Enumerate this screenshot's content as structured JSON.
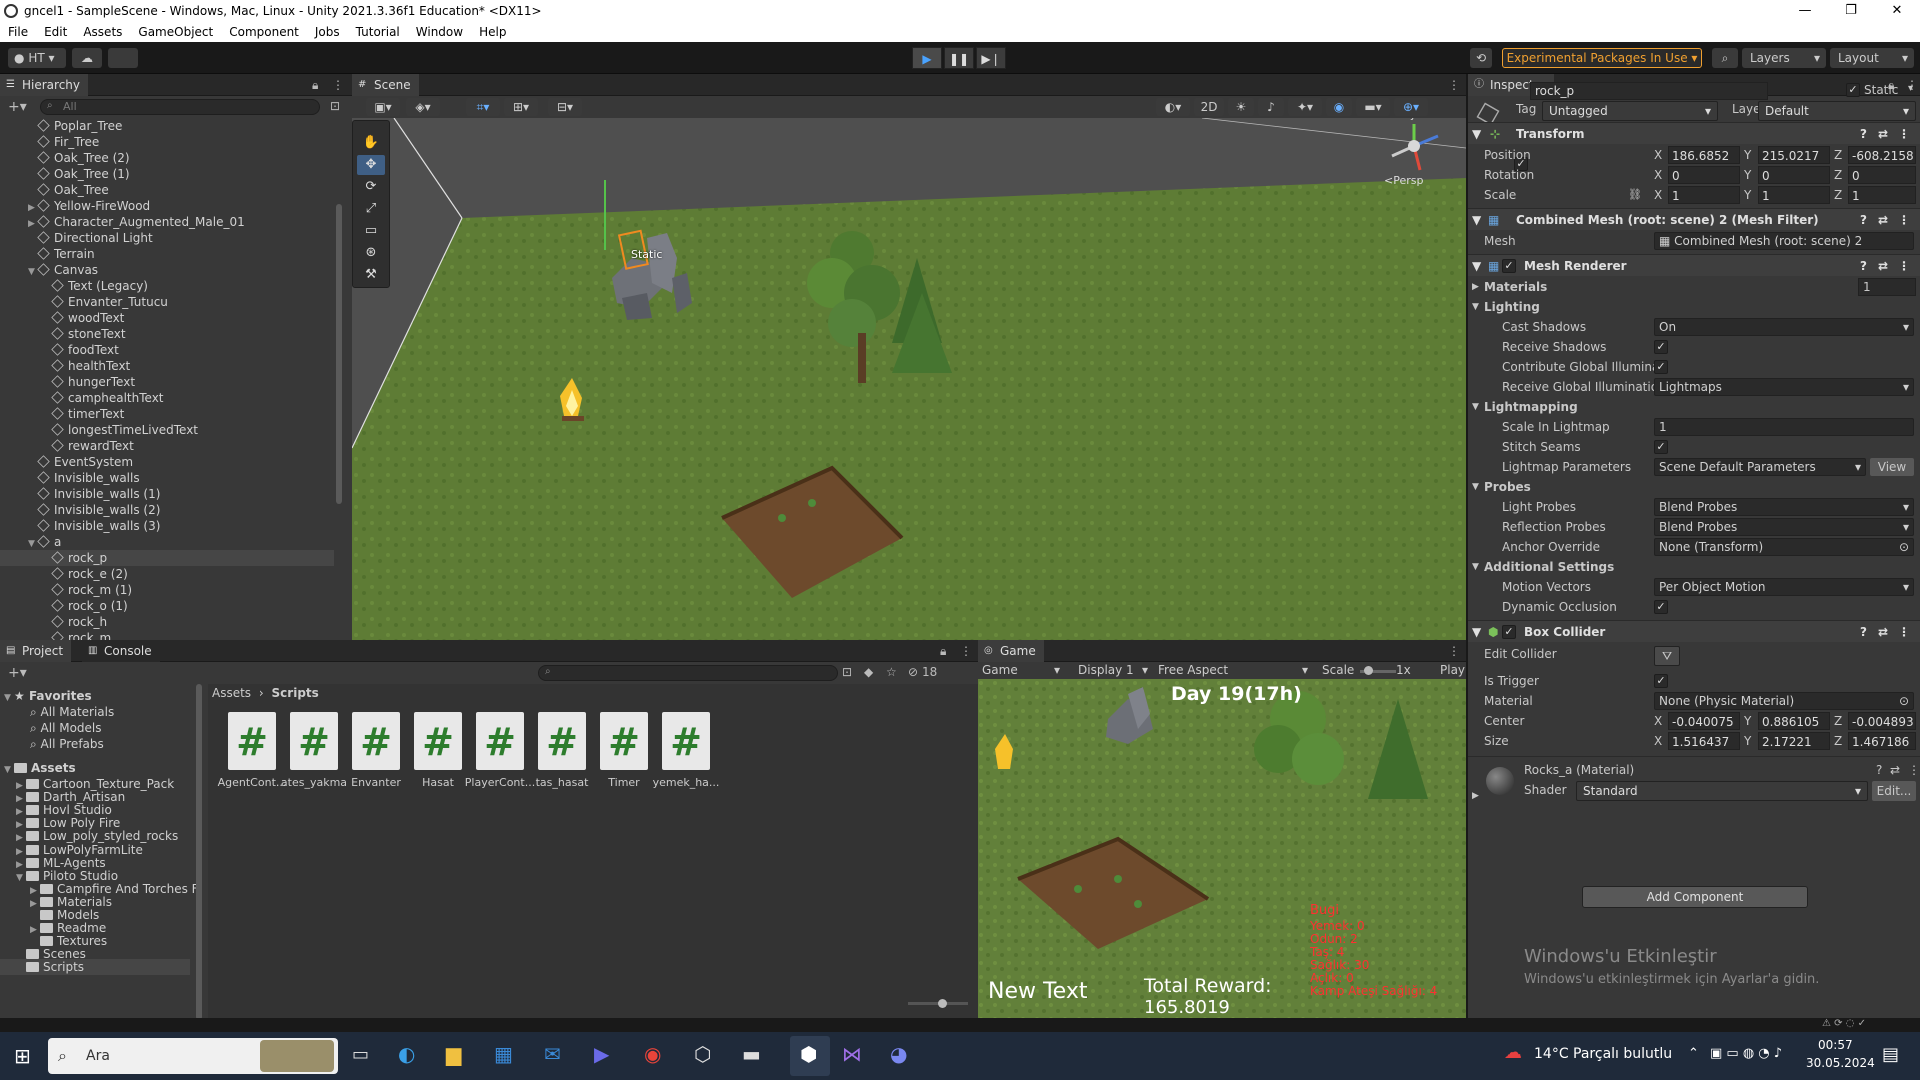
{
  "window": {
    "title": "gncel1 - SampleScene - Windows, Mac, Linux - Unity 2021.3.36f1 Education* <DX11>",
    "controls": [
      "—",
      "❐",
      "✕"
    ]
  },
  "menu": [
    "File",
    "Edit",
    "Assets",
    "GameObject",
    "Component",
    "Jobs",
    "Tutorial",
    "Window",
    "Help"
  ],
  "toolbar": {
    "account": "HT",
    "experimental": "Experimental Packages In Use",
    "layers": "Layers",
    "layout": "Layout"
  },
  "hierarchy": {
    "title": "Hierarchy",
    "search_placeholder": "All",
    "items": [
      {
        "label": "Poplar_Tree",
        "depth": 1,
        "arrow": ""
      },
      {
        "label": "Fir_Tree",
        "depth": 1,
        "arrow": ""
      },
      {
        "label": "Oak_Tree (2)",
        "depth": 1,
        "arrow": ""
      },
      {
        "label": "Oak_Tree (1)",
        "depth": 1,
        "arrow": ""
      },
      {
        "label": "Oak_Tree",
        "depth": 1,
        "arrow": ""
      },
      {
        "label": "Yellow-FireWood",
        "depth": 1,
        "arrow": "▶"
      },
      {
        "label": "Character_Augmented_Male_01",
        "depth": 1,
        "arrow": "▶"
      },
      {
        "label": "Directional Light",
        "depth": 1,
        "arrow": ""
      },
      {
        "label": "Terrain",
        "depth": 1,
        "arrow": ""
      },
      {
        "label": "Canvas",
        "depth": 1,
        "arrow": "▼"
      },
      {
        "label": "Text (Legacy)",
        "depth": 2,
        "arrow": ""
      },
      {
        "label": "Envanter_Tutucu",
        "depth": 2,
        "arrow": ""
      },
      {
        "label": "woodText",
        "depth": 2,
        "arrow": ""
      },
      {
        "label": "stoneText",
        "depth": 2,
        "arrow": ""
      },
      {
        "label": "foodText",
        "depth": 2,
        "arrow": ""
      },
      {
        "label": "healthText",
        "depth": 2,
        "arrow": ""
      },
      {
        "label": "hungerText",
        "depth": 2,
        "arrow": ""
      },
      {
        "label": "camphealthText",
        "depth": 2,
        "arrow": ""
      },
      {
        "label": "timerText",
        "depth": 2,
        "arrow": ""
      },
      {
        "label": "longestTimeLivedText",
        "depth": 2,
        "arrow": ""
      },
      {
        "label": "rewardText",
        "depth": 2,
        "arrow": ""
      },
      {
        "label": "EventSystem",
        "depth": 1,
        "arrow": ""
      },
      {
        "label": "Invisible_walls",
        "depth": 1,
        "arrow": ""
      },
      {
        "label": "Invisible_walls (1)",
        "depth": 1,
        "arrow": ""
      },
      {
        "label": "Invisible_walls (2)",
        "depth": 1,
        "arrow": ""
      },
      {
        "label": "Invisible_walls (3)",
        "depth": 1,
        "arrow": ""
      },
      {
        "label": "a",
        "depth": 1,
        "arrow": "▼"
      },
      {
        "label": "rock_p",
        "depth": 2,
        "arrow": "",
        "selected": true
      },
      {
        "label": "rock_e (2)",
        "depth": 2,
        "arrow": ""
      },
      {
        "label": "rock_m (1)",
        "depth": 2,
        "arrow": ""
      },
      {
        "label": "rock_o (1)",
        "depth": 2,
        "arrow": ""
      },
      {
        "label": "rock_h",
        "depth": 2,
        "arrow": ""
      },
      {
        "label": "rock_m",
        "depth": 2,
        "arrow": ""
      }
    ]
  },
  "scene": {
    "tab": "Scene",
    "mode_2d": "2D",
    "persp": "<Persp",
    "static_label": "Static",
    "gizmo_y": "y"
  },
  "project": {
    "tab_project": "Project",
    "tab_console": "Console",
    "favorites_label": "Favorites",
    "favorites": [
      "All Materials",
      "All Models",
      "All Prefabs"
    ],
    "assets_label": "Assets",
    "folders": [
      {
        "label": "Cartoon_Texture_Pack",
        "depth": 1,
        "arrow": "▶"
      },
      {
        "label": "Darth_Artisan",
        "depth": 1,
        "arrow": "▶"
      },
      {
        "label": "Hovl Studio",
        "depth": 1,
        "arrow": "▶"
      },
      {
        "label": "Low Poly Fire",
        "depth": 1,
        "arrow": "▶"
      },
      {
        "label": "Low_poly_styled_rocks",
        "depth": 1,
        "arrow": "▶"
      },
      {
        "label": "LowPolyFarmLite",
        "depth": 1,
        "arrow": "▶"
      },
      {
        "label": "ML-Agents",
        "depth": 1,
        "arrow": "▶"
      },
      {
        "label": "Piloto Studio",
        "depth": 1,
        "arrow": "▼"
      },
      {
        "label": "Campfire And Torches F",
        "depth": 2,
        "arrow": "▶"
      },
      {
        "label": "Materials",
        "depth": 2,
        "arrow": "▶"
      },
      {
        "label": "Models",
        "depth": 2,
        "arrow": ""
      },
      {
        "label": "Readme",
        "depth": 2,
        "arrow": "▶"
      },
      {
        "label": "Textures",
        "depth": 2,
        "arrow": ""
      },
      {
        "label": "Scenes",
        "depth": 1,
        "arrow": ""
      },
      {
        "label": "Scripts",
        "depth": 1,
        "arrow": "",
        "selected": true
      }
    ],
    "breadcrumb": [
      "Assets",
      "Scripts"
    ],
    "count": "18",
    "files": [
      "AgentCont...",
      "ates_yakma",
      "Envanter",
      "Hasat",
      "PlayerCont...",
      "tas_hasat",
      "Timer",
      "yemek_ha..."
    ]
  },
  "game": {
    "tab": "Game",
    "mode": "Game",
    "display": "Display 1",
    "aspect": "Free Aspect",
    "scale_label": "Scale",
    "scale_value": "1x",
    "play_focus": "Play",
    "hud": {
      "day": "Day 19(17h)",
      "new_text": "New Text",
      "total_reward": "Total Reward:",
      "reward_value": "165.8019",
      "bugi": "Bugi",
      "stats": [
        "Yemek: 0",
        "Odun: 2",
        "Taş: 4",
        "Sağlık: 30",
        "Açlık: 0",
        "Kamp Ateşi Sağlığı: 4"
      ]
    }
  },
  "inspector": {
    "tab": "Inspector",
    "object_name": "rock_p",
    "static_label": "Static",
    "tag_label": "Tag",
    "tag_value": "Untagged",
    "layer_label": "Layer",
    "layer_value": "Default",
    "transform": {
      "title": "Transform",
      "position_label": "Position",
      "rotation_label": "Rotation",
      "scale_label": "Scale",
      "position": [
        "186.6852",
        "215.0217",
        "-608.2158"
      ],
      "rotation": [
        "0",
        "0",
        "0"
      ],
      "scale": [
        "1",
        "1",
        "1"
      ]
    },
    "mesh_filter": {
      "title": "Combined Mesh (root: scene) 2 (Mesh Filter)",
      "mesh_label": "Mesh",
      "mesh_value": "Combined Mesh (root: scene) 2"
    },
    "mesh_renderer": {
      "title": "Mesh Renderer",
      "materials_label": "Materials",
      "materials_count": "1",
      "lighting_label": "Lighting",
      "cast_shadows_label": "Cast Shadows",
      "cast_shadows_value": "On",
      "receive_shadows_label": "Receive Shadows",
      "contribute_gi_label": "Contribute Global Illuminat",
      "receive_gi_label": "Receive Global Illuminatior",
      "receive_gi_value": "Lightmaps",
      "lightmapping_label": "Lightmapping",
      "scale_in_lightmap_label": "Scale In Lightmap",
      "scale_in_lightmap_value": "1",
      "stitch_seams_label": "Stitch Seams",
      "lightmap_params_label": "Lightmap Parameters",
      "lightmap_params_value": "Scene Default Parameters",
      "view_button": "View",
      "probes_label": "Probes",
      "light_probes_label": "Light Probes",
      "light_probes_value": "Blend Probes",
      "reflection_probes_label": "Reflection Probes",
      "reflection_probes_value": "Blend Probes",
      "anchor_override_label": "Anchor Override",
      "anchor_override_value": "None (Transform)",
      "additional_label": "Additional Settings",
      "motion_vectors_label": "Motion Vectors",
      "motion_vectors_value": "Per Object Motion",
      "dynamic_occlusion_label": "Dynamic Occlusion"
    },
    "box_collider": {
      "title": "Box Collider",
      "edit_collider_label": "Edit Collider",
      "is_trigger_label": "Is Trigger",
      "material_label": "Material",
      "material_value": "None (Physic Material)",
      "center_label": "Center",
      "size_label": "Size",
      "center": [
        "-0.040075",
        "0.886105",
        "-0.004893"
      ],
      "size": [
        "1.516437",
        "2.17221",
        "1.467186"
      ]
    },
    "material": {
      "title": "Rocks_a (Material)",
      "shader_label": "Shader",
      "shader_value": "Standard",
      "edit_button": "Edit..."
    },
    "add_component": "Add Component",
    "watermark_title": "Windows'u Etkinleştir",
    "watermark_sub": "Windows'u etkinleştirmek için Ayarlar'a gidin."
  },
  "taskbar": {
    "search": "Ara",
    "weather": "14°C  Parçalı bulutlu",
    "time": "00:57",
    "date": "30.05.2024"
  }
}
